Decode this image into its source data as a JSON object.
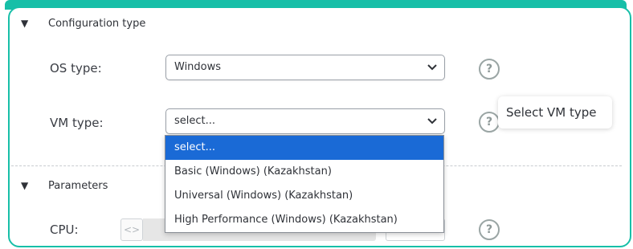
{
  "sections": {
    "config": {
      "title": "Configuration type",
      "toggle": "▼"
    },
    "params": {
      "title": "Parameters",
      "toggle": "▼"
    }
  },
  "os_type": {
    "label": "OS type:",
    "value": "Windows"
  },
  "vm_type": {
    "label": "VM type:",
    "value": "select...",
    "tooltip": "Select VM type",
    "options": [
      "select...",
      "Basic (Windows) (Kazakhstan)",
      "Universal (Windows) (Kazakhstan)",
      "High Performance (Windows) (Kazakhstan)"
    ],
    "highlighted_index": 0
  },
  "cpu": {
    "label": "CPU:",
    "stepper_glyph": "<>"
  },
  "help_glyph": "?",
  "colors": {
    "accent": "#17bfa8",
    "highlight": "#1a6ad6"
  },
  "icons": {
    "help": "question-circle-icon",
    "chevron": "chevron-down-icon",
    "toggle": "triangle-down-icon"
  }
}
